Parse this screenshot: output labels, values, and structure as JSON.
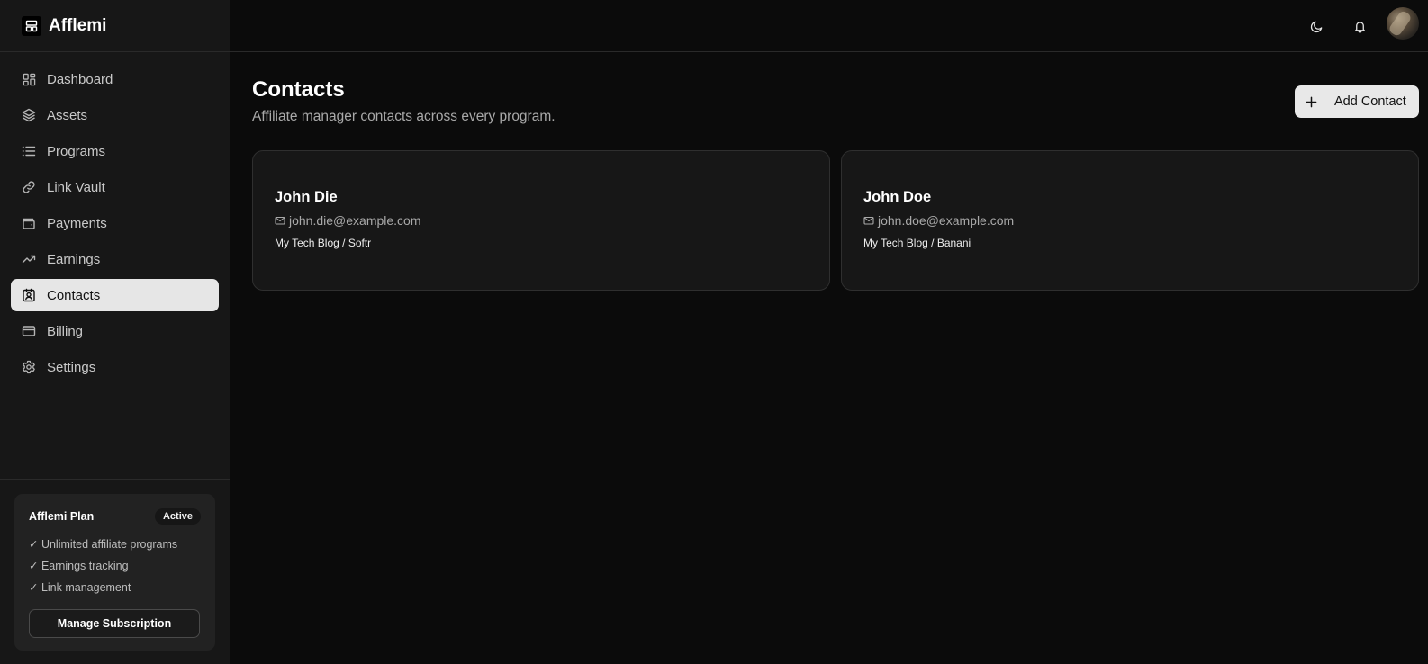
{
  "app": {
    "name": "Afflemi"
  },
  "sidebar": {
    "items": [
      {
        "label": "Dashboard",
        "icon": "dashboard-icon"
      },
      {
        "label": "Assets",
        "icon": "layers-icon"
      },
      {
        "label": "Programs",
        "icon": "list-icon"
      },
      {
        "label": "Link Vault",
        "icon": "link-icon"
      },
      {
        "label": "Payments",
        "icon": "wallet-icon"
      },
      {
        "label": "Earnings",
        "icon": "trending-up-icon"
      },
      {
        "label": "Contacts",
        "icon": "contact-card-icon",
        "active": true
      },
      {
        "label": "Billing",
        "icon": "credit-card-icon"
      },
      {
        "label": "Settings",
        "icon": "gear-icon"
      }
    ]
  },
  "plan": {
    "title": "Afflemi Plan",
    "badge": "Active",
    "features": [
      "✓ Unlimited affiliate programs",
      "✓ Earnings tracking",
      "✓ Link management"
    ],
    "manage_label": "Manage Subscription"
  },
  "topbar": {
    "icons": [
      "moon-icon",
      "bell-icon",
      "avatar"
    ]
  },
  "page": {
    "title": "Contacts",
    "subtitle": "Affiliate manager contacts across every program.",
    "add_label": "Add Contact"
  },
  "contacts": [
    {
      "name": "John Die",
      "email": "john.die@example.com",
      "meta": "My Tech Blog / Softr"
    },
    {
      "name": "John Doe",
      "email": "john.doe@example.com",
      "meta": "My Tech Blog / Banani"
    }
  ],
  "colors": {
    "background": "#0b0b0b",
    "sidebar": "#171717",
    "active_item": "#e6e6e6",
    "card": "#171717",
    "button": "#e8e8e8"
  }
}
